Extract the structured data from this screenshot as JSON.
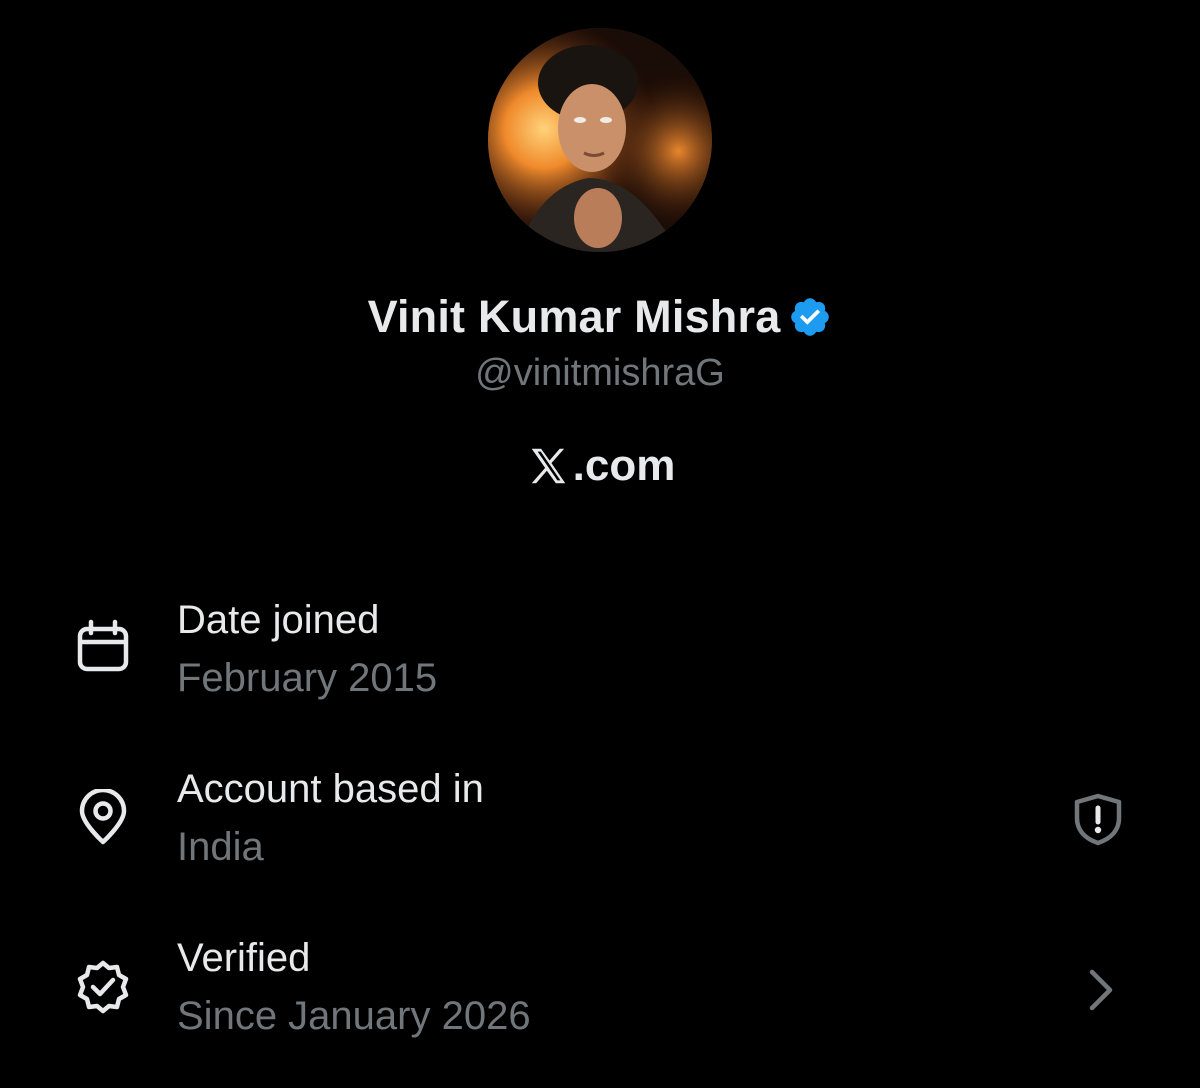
{
  "profile": {
    "display_name": "Vinit Kumar Mishra",
    "handle": "@vinitmishraG",
    "verified_badge_color": "#1d9bf0",
    "brand": {
      "logo_icon": "x-logo-icon",
      "text": ".com"
    }
  },
  "about": {
    "rows": [
      {
        "icon": "calendar-icon",
        "title": "Date joined",
        "value": "February 2015"
      },
      {
        "icon": "location-pin-icon",
        "title": "Account based in",
        "value": "India",
        "right_icon": "shield-alert-icon"
      },
      {
        "icon": "verified-badge-outline-icon",
        "title": "Verified",
        "value": "Since January 2026",
        "right_icon": "chevron-right-icon"
      }
    ]
  },
  "colors": {
    "background": "#000000",
    "primary_text": "#e7e9ea",
    "secondary_text": "#71767b",
    "accent_blue": "#1d9bf0"
  }
}
